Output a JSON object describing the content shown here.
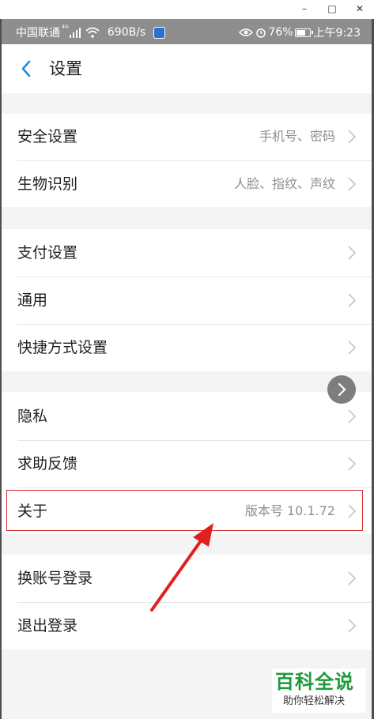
{
  "window_controls": {
    "minimize": "–",
    "maximize": "□",
    "close": "✕"
  },
  "status_bar": {
    "carrier": "中国联通",
    "network": "⁴ᴳ",
    "speed": "690B/s",
    "battery_text": "76%",
    "battery_level": 0.76,
    "time": "上午9:23"
  },
  "header": {
    "title": "设置",
    "back_icon": "chevron-left-icon"
  },
  "groups": [
    {
      "items": [
        {
          "label": "安全设置",
          "value": "手机号、密码"
        },
        {
          "label": "生物识别",
          "value": "人脸、指纹、声纹"
        }
      ]
    },
    {
      "items": [
        {
          "label": "支付设置",
          "value": ""
        },
        {
          "label": "通用",
          "value": ""
        },
        {
          "label": "快捷方式设置",
          "value": ""
        }
      ]
    },
    {
      "items": [
        {
          "label": "隐私",
          "value": ""
        },
        {
          "label": "求助反馈",
          "value": ""
        },
        {
          "label": "关于",
          "value": "版本号 10.1.72"
        }
      ]
    },
    {
      "items": [
        {
          "label": "换账号登录",
          "value": ""
        },
        {
          "label": "退出登录",
          "value": ""
        }
      ]
    }
  ],
  "colors": {
    "accent": "#1a8fe6",
    "highlight": "#d62b2b",
    "watermark": "#1e9a3c"
  },
  "watermark": {
    "title": "百科全说",
    "subtitle": "助你轻松解决"
  }
}
